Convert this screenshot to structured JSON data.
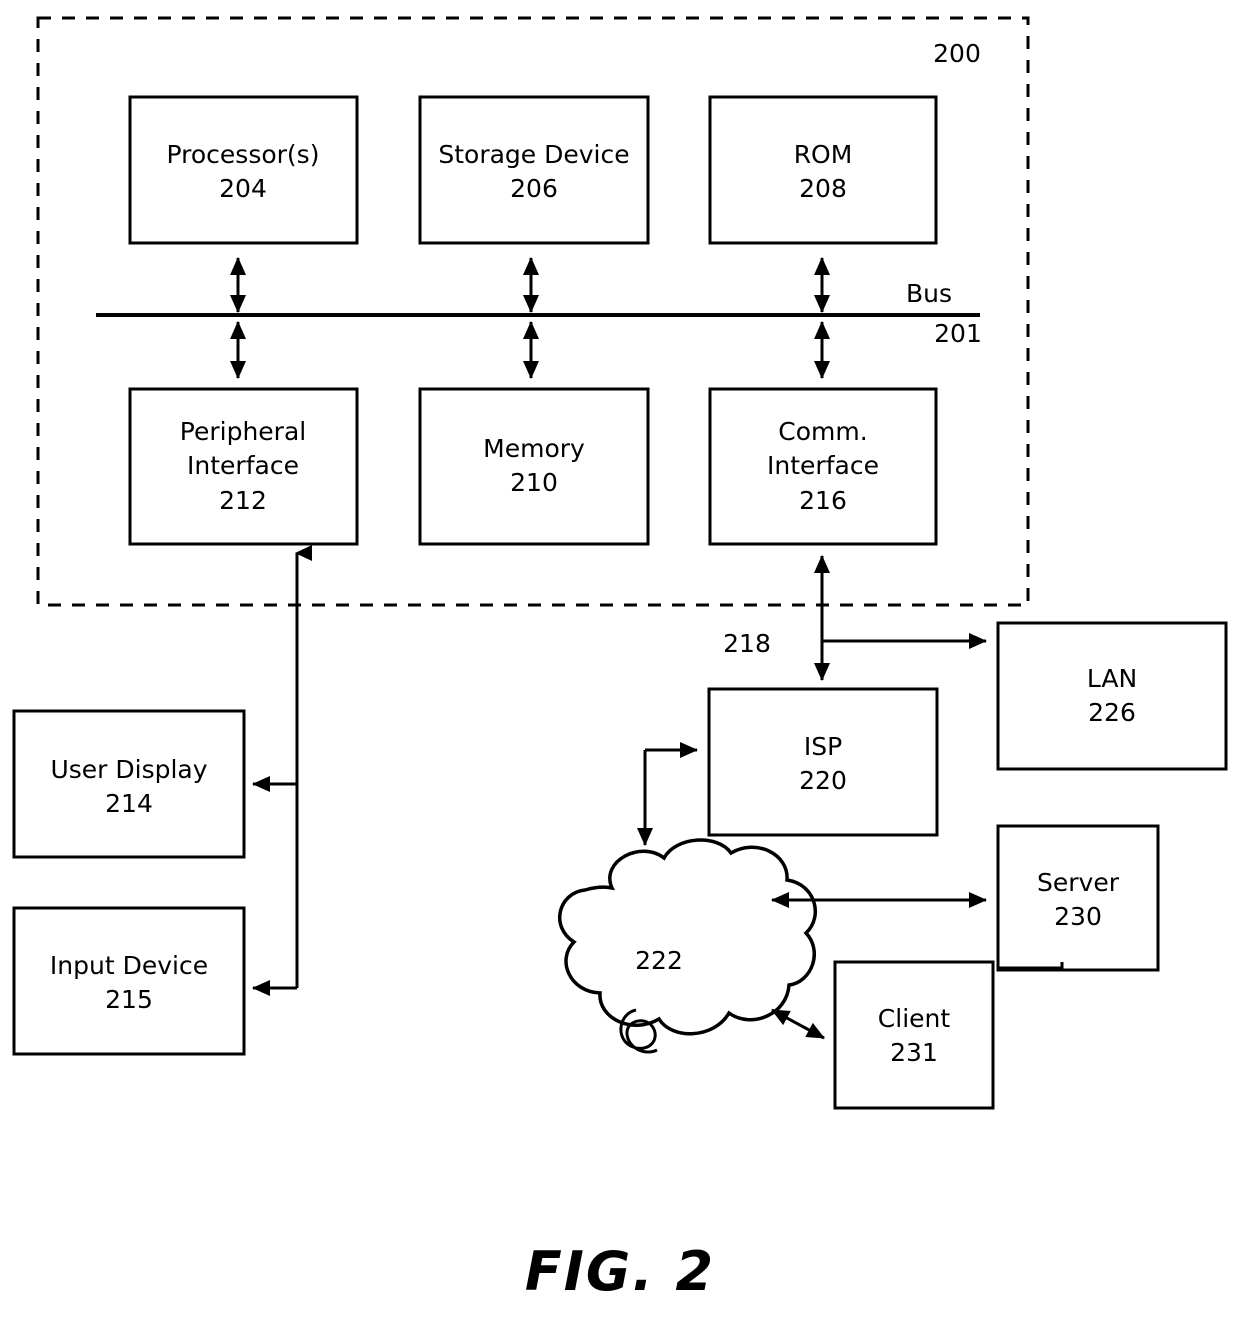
{
  "figure": {
    "caption": "FIG. 2",
    "system_ref": "200",
    "bus_label": "Bus",
    "bus_ref": "201",
    "comm_link_ref": "218"
  },
  "boxes": {
    "processor": {
      "label": "Processor(s)",
      "ref": "204"
    },
    "storage": {
      "label": "Storage Device",
      "ref": "206"
    },
    "rom": {
      "label": "ROM",
      "ref": "208"
    },
    "peripheral": {
      "label_line1": "Peripheral",
      "label_line2": "Interface",
      "ref": "212"
    },
    "memory": {
      "label": "Memory",
      "ref": "210"
    },
    "comm": {
      "label_line1": "Comm.",
      "label_line2": "Interface",
      "ref": "216"
    },
    "user_display": {
      "label": "User Display",
      "ref": "214"
    },
    "input_device": {
      "label": "Input Device",
      "ref": "215"
    },
    "isp": {
      "label": "ISP",
      "ref": "220"
    },
    "lan": {
      "label": "LAN",
      "ref": "226"
    },
    "server": {
      "label": "Server",
      "ref": "230"
    },
    "client": {
      "label": "Client",
      "ref": "231"
    }
  },
  "cloud": {
    "ref": "222"
  },
  "colors": {
    "stroke": "#000000",
    "fill": "#ffffff"
  }
}
